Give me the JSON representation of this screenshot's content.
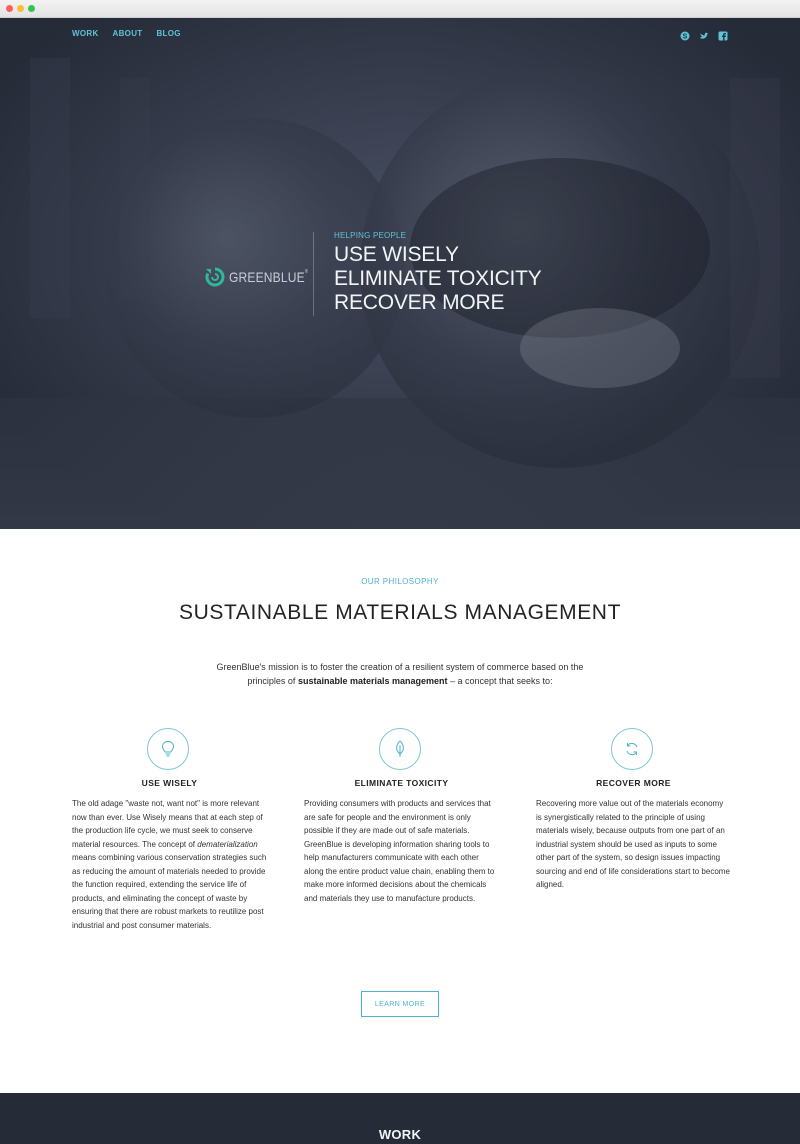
{
  "nav": {
    "items": [
      "WORK",
      "ABOUT",
      "BLOG"
    ]
  },
  "social": {
    "icons": [
      "skype-icon",
      "twitter-icon",
      "facebook-icon"
    ]
  },
  "brand": {
    "name": "GREENBLUE",
    "mark": "®"
  },
  "hero": {
    "eyebrow": "HELPING PEOPLE",
    "lines": [
      "USE WISELY",
      "ELIMINATE TOXICITY",
      "RECOVER MORE"
    ]
  },
  "philosophy": {
    "eyebrow": "OUR PHILOSOPHY",
    "title": "SUSTAINABLE MATERIALS MANAGEMENT",
    "intro_start": "GreenBlue's mission is to foster the creation of a resilient system of commerce based on the principles of ",
    "intro_bold": "sustainable materials management",
    "intro_end": " – a concept that seeks to:"
  },
  "columns": [
    {
      "icon": "lightbulb-icon",
      "title": "USE WISELY",
      "body_start": "The old adage \"waste not, want not\" is more relevant now than ever. Use Wisely means that at each step of the production life cycle, we must seek to conserve material resources. The concept of ",
      "body_italic": "dematerialization",
      "body_end": " means combining various conservation strategies such as reducing the amount of materials needed to provide the function required, extending the service life of products, and eliminating the concept of waste by ensuring that there are robust markets to reutilize post industrial and post consumer materials."
    },
    {
      "icon": "leaf-icon",
      "title": "ELIMINATE TOXICITY",
      "body": "Providing consumers with products and services that are safe for people and the environment is only possible if they are made out of safe materials. GreenBlue is developing information sharing tools to help manufacturers communicate with each other along the entire product value chain, enabling them to make more informed decisions about the chemicals and materials they use to manufacture products."
    },
    {
      "icon": "recycle-icon",
      "title": "RECOVER MORE",
      "body": "Recovering more value out of the materials economy is synergistically related to the principle of using materials wisely, because outputs from one part of an industrial system should be used as inputs to some other part of the system, so design issues impacting sourcing and end of life considerations start to become aligned."
    }
  ],
  "cta": {
    "learn_more": "LEARN MORE"
  },
  "work_section": {
    "title": "WORK"
  },
  "colors": {
    "accent": "#4fb3c7",
    "brand_green": "#2fb89a",
    "dark": "#262b38"
  }
}
